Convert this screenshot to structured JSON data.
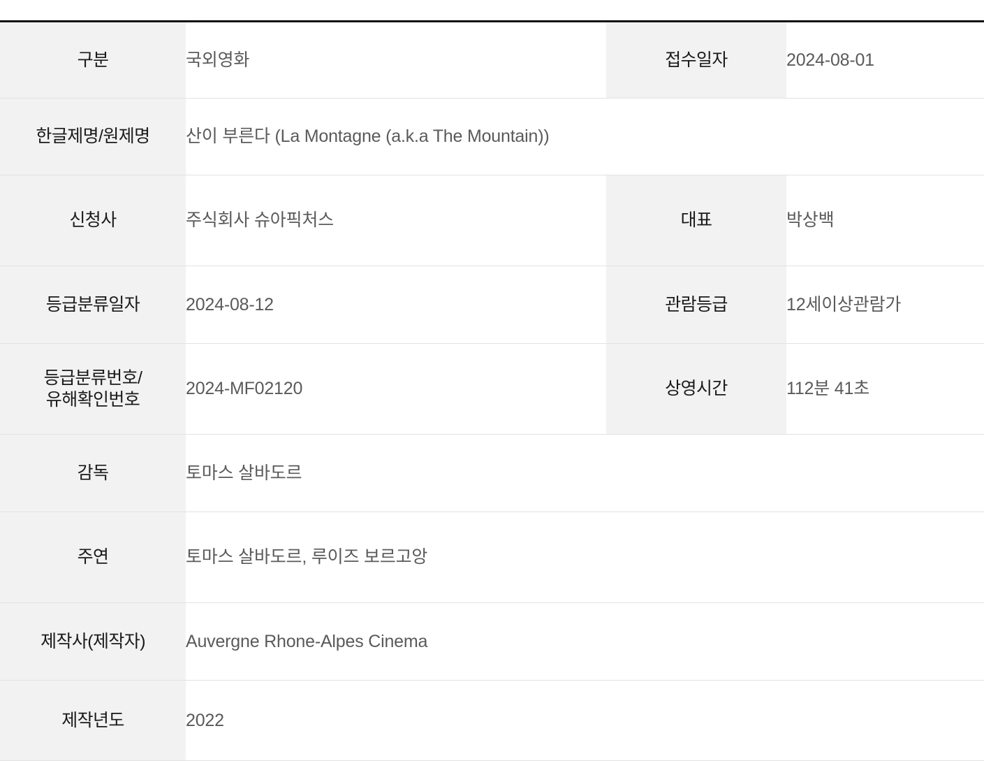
{
  "table": {
    "rows": [
      {
        "label": "구분",
        "value": "국외영화",
        "label2": "접수일자",
        "value2": "2024-08-01"
      },
      {
        "label": "한글제명/원제명",
        "value": "산이 부른다  (La Montagne (a.k.a The Mountain))",
        "label2": "",
        "value2": ""
      },
      {
        "label": "신청사",
        "value": "주식회사 슈아픽처스",
        "label2": "대표",
        "value2": "박상백"
      },
      {
        "label": "등급분류일자",
        "value": "2024-08-12",
        "label2": "관람등급",
        "value2": "12세이상관람가"
      },
      {
        "label_line1": "등급분류번호/",
        "label_line2": "유해확인번호",
        "value": "2024-MF02120",
        "label2": "상영시간",
        "value2": "112분 41초"
      },
      {
        "label": "감독",
        "value": "토마스 살바도르",
        "label2": "",
        "value2": ""
      },
      {
        "label": "주연",
        "value": "토마스 살바도르, 루이즈 보르고앙",
        "label2": "",
        "value2": ""
      },
      {
        "label": "제작사(제작자)",
        "value": "Auvergne Rhone-Alpes Cinema",
        "label2": "",
        "value2": ""
      },
      {
        "label": "제작년도",
        "value": "2022",
        "label2": "",
        "value2": ""
      }
    ]
  },
  "colors": {
    "label_background": "#f2f2f2",
    "label_text": "#1a1a1a",
    "value_text": "#5a5a5a",
    "row_divider": "#e2e2e2",
    "top_border": "#111111",
    "page_background": "#ffffff"
  }
}
